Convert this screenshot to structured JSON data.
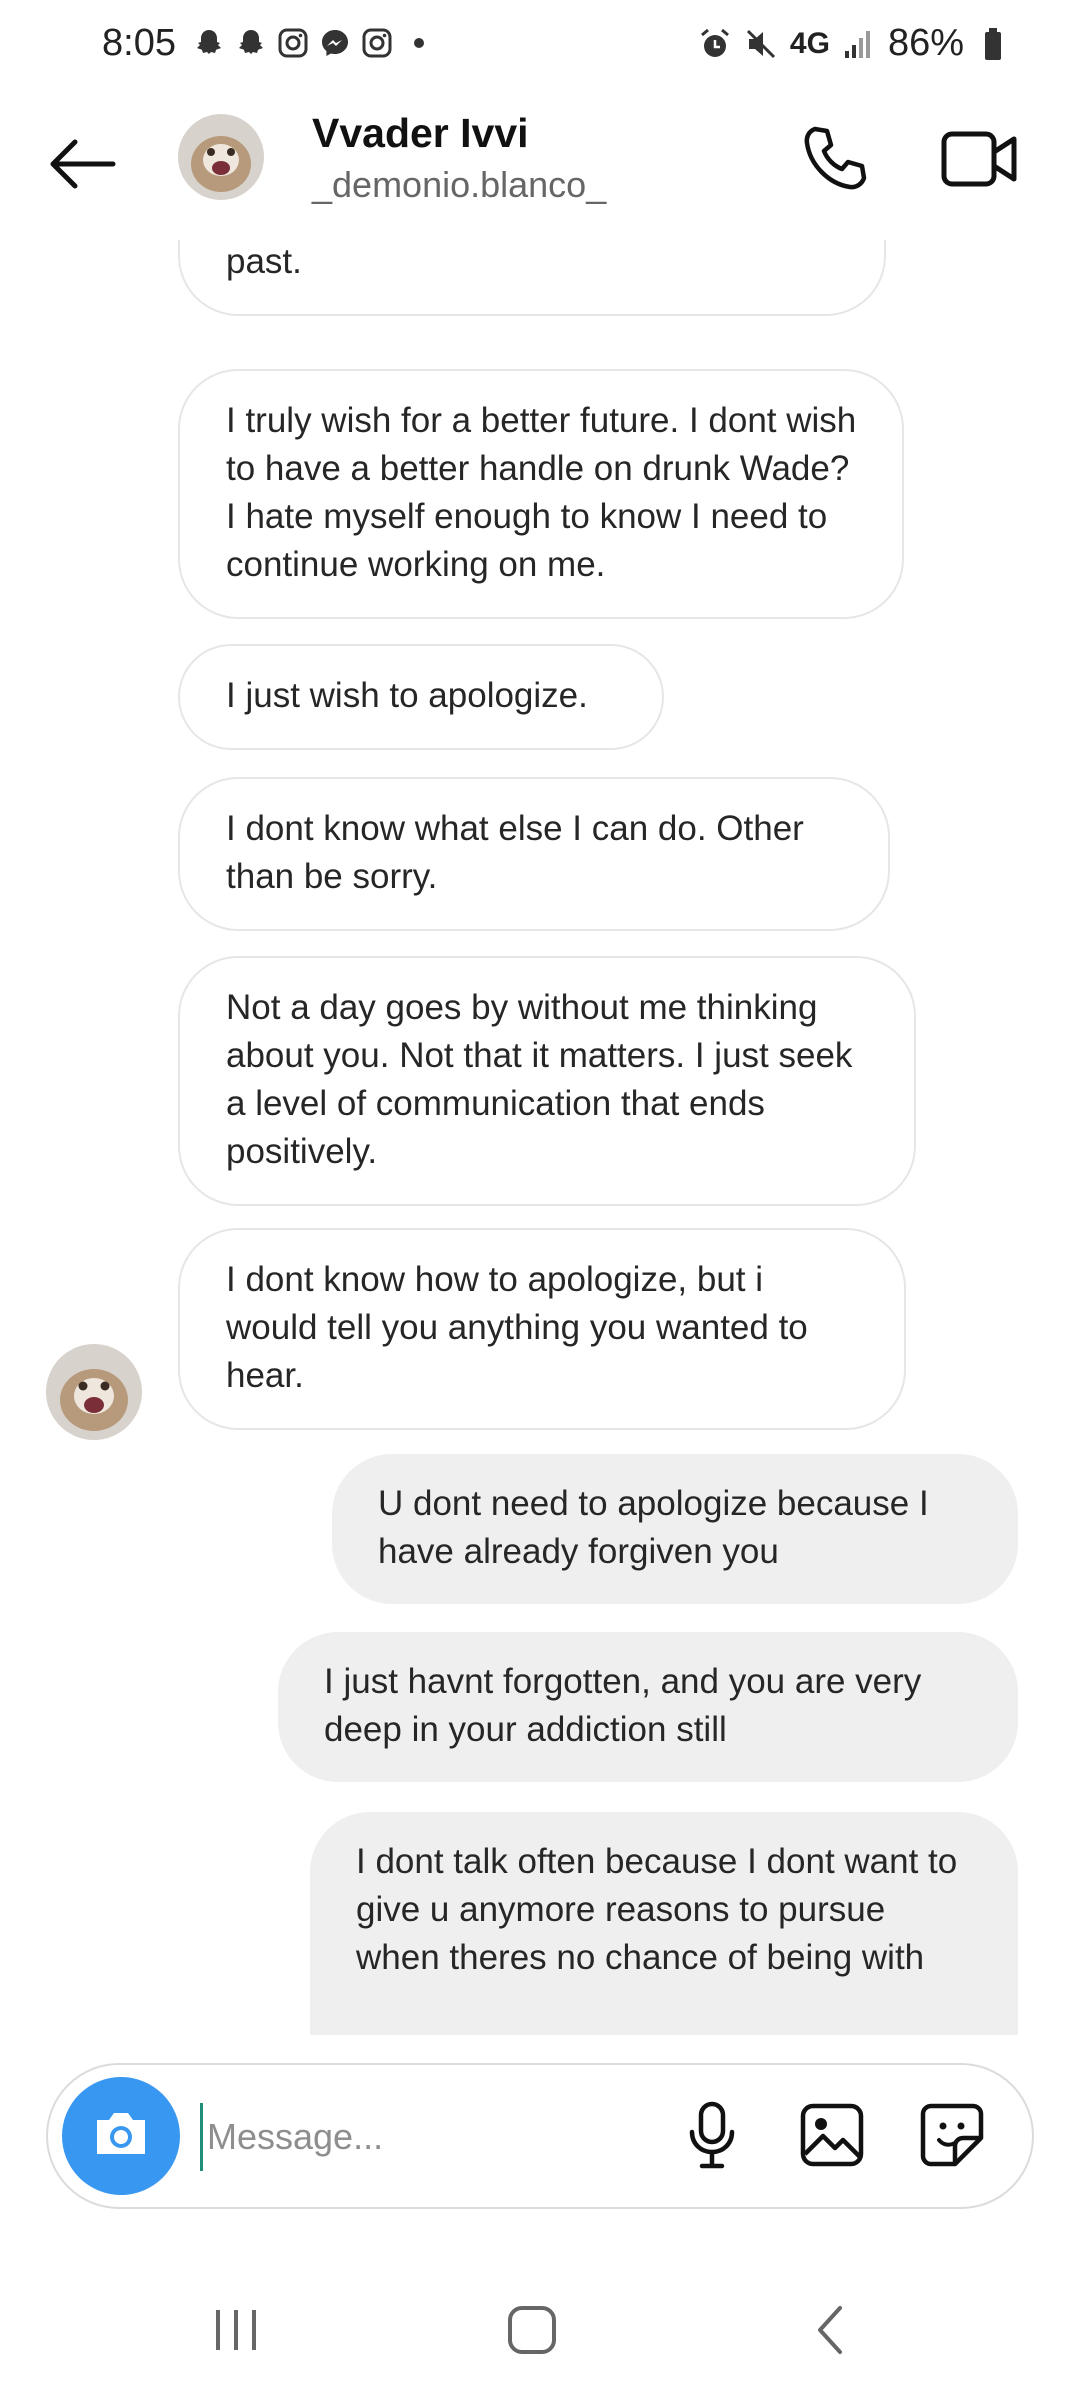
{
  "status_bar": {
    "time": "8:05",
    "network": "4G",
    "battery": "86%",
    "left_icons": [
      "snapchat-icon",
      "snapchat-icon",
      "instagram-icon",
      "messenger-icon",
      "instagram-icon",
      "dot-icon"
    ],
    "right_icons": [
      "alarm-icon",
      "mute-icon",
      "signal-icon",
      "battery-icon"
    ]
  },
  "header": {
    "name": "Vvader Ivvi",
    "username": "_demonio.blanco_",
    "icons": [
      "back-arrow-icon",
      "phone-icon",
      "video-camera-icon"
    ]
  },
  "messages": [
    {
      "direction": "in",
      "text": "Communicate a desire for a different past."
    },
    {
      "direction": "in",
      "text": "I truly wish for a better future. I dont wish to have a better handle on drunk Wade? I hate myself enough to know I need to continue working on me."
    },
    {
      "direction": "in",
      "text": "I just wish to apologize."
    },
    {
      "direction": "in",
      "text": "I dont know what else I can do. Other than be sorry."
    },
    {
      "direction": "in",
      "text": "Not a day goes by without me thinking about you. Not that it matters. I just seek a level of communication that ends positively."
    },
    {
      "direction": "in",
      "text": "I dont know how to apologize, but i would tell you anything you wanted to hear."
    },
    {
      "direction": "out",
      "text": "U dont need to apologize because I have already forgiven you"
    },
    {
      "direction": "out",
      "text": "I just havnt forgotten, and you are very deep in your addiction still"
    },
    {
      "direction": "out",
      "text": "I dont talk often because I dont want to give u anymore reasons to pursue when theres no chance of being with"
    }
  ],
  "composer": {
    "placeholder": "Message...",
    "value": "",
    "icons": [
      "camera-icon",
      "microphone-icon",
      "gallery-icon",
      "sticker-icon"
    ]
  },
  "colors": {
    "camera_button": "#3897f0",
    "outgoing_bubble": "#efefef",
    "incoming_border": "#e6e6e6"
  },
  "nav_bar": {
    "icons": [
      "recent-apps-icon",
      "home-icon",
      "back-icon"
    ]
  }
}
